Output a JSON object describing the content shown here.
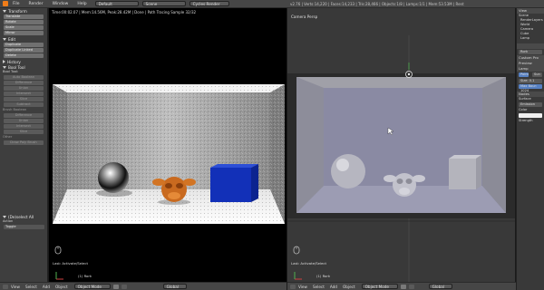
{
  "topbar": {
    "menus": [
      "File",
      "Render",
      "Window",
      "Help"
    ],
    "layout": "Default",
    "scene": "Scene",
    "engine": "Cycles Render",
    "stats": "v2.76 | Verts:14,220 | Faces:14,233 | Tris:28,466 | Objects:1/8 | Lamps:1/1 | Mem:53.53M | Rent"
  },
  "toolshelf": {
    "transform": {
      "header": "Transform",
      "buttons": [
        "Translate",
        "Rotate",
        "Scale",
        "Mirror"
      ]
    },
    "edit": {
      "header": "Edit",
      "buttons": [
        "Duplicate",
        "Duplicate Linked",
        "Delete"
      ]
    },
    "history": {
      "header": "History"
    },
    "bool": {
      "header": "Bool Tool",
      "label": "Bool Tool:",
      "items": [
        "Auto Boolean",
        "Difference",
        "Union",
        "Intersect",
        "Slice",
        "Subtract"
      ],
      "brush_label": "Brush Boolean",
      "brush_items": [
        "Difference",
        "Union",
        "Intersect",
        "Slice"
      ],
      "other_label": "Other",
      "other_items": [
        "Draw Poly Brush"
      ]
    },
    "operator": {
      "header": "(De)select All",
      "action_label": "Action",
      "action_value": "Toggle"
    }
  },
  "render_view": {
    "status": "Time:00:02.07 | Mem:14.56M, Peak:28.42M | Done | Path Tracing Sample 32/32",
    "selection_text": "(1) Rork",
    "last_op": "Last: Activate/Select"
  },
  "camera_view": {
    "label": "Camera Persp",
    "selection_text": "(1) Rork",
    "last_op": "Last: Activate/Select"
  },
  "bottombar_left": {
    "menus": [
      "View",
      "Select",
      "Add",
      "Object"
    ],
    "mode": "Object Mode",
    "orientation": "Global"
  },
  "bottombar_right": {
    "menus": [
      "View",
      "Select",
      "Add",
      "Object"
    ],
    "mode": "Object Mode",
    "orientation": "Global"
  },
  "properties": {
    "tabs": [
      "View",
      "Search"
    ],
    "outliner": [
      "Scene",
      "RenderLayers",
      "World",
      "Camera",
      "Cube",
      "Lamp"
    ],
    "object_name": "Rork",
    "sections": [
      "Custom Pro",
      "Preview",
      "Lamp"
    ],
    "lamp_tabs": [
      "Point",
      "Sun"
    ],
    "size_label": "Size:",
    "size_value": "0.1",
    "max_bounces": "Max Bour: 1024",
    "nodes_header": "Nodes",
    "surface_label": "Surface",
    "surface_value": "Emission",
    "color_label": "Color",
    "strength_label": "Strength"
  },
  "colors": {
    "accent_blue": "#5680c2",
    "brand_orange": "#f07c18",
    "panel_bg": "#3e3e3e",
    "header_bg": "#464646",
    "cube_blue": "#1133bb",
    "monkey_orange": "#d8701e"
  }
}
